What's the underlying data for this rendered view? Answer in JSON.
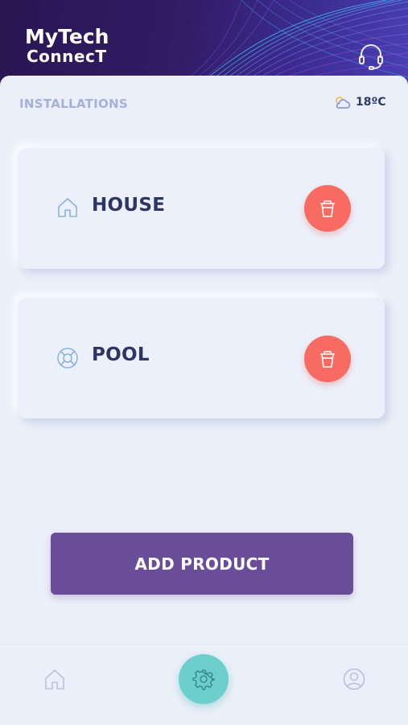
{
  "app": {
    "logo_line1": "MyTech",
    "logo_line2": "ConnecT"
  },
  "section": {
    "title": "INSTALLATIONS"
  },
  "weather": {
    "icon": "partly-cloudy-icon",
    "temperature": "18ºC"
  },
  "installations": [
    {
      "label": "HOUSE",
      "icon": "house-icon",
      "delete_icon": "trash-icon"
    },
    {
      "label": "POOL",
      "icon": "lifebuoy-icon",
      "delete_icon": "trash-icon"
    }
  ],
  "actions": {
    "add_product_label": "ADD PRODUCT"
  },
  "bottom_nav": {
    "items": [
      "home-icon",
      "settings-icon",
      "profile-icon"
    ]
  },
  "colors": {
    "header": "#2a1652",
    "accent_purple": "#6a4d98",
    "delete_red": "#f76b62",
    "settings_teal": "#6ccfcb",
    "text_dark": "#2d3566",
    "text_muted": "#a6b1da"
  }
}
